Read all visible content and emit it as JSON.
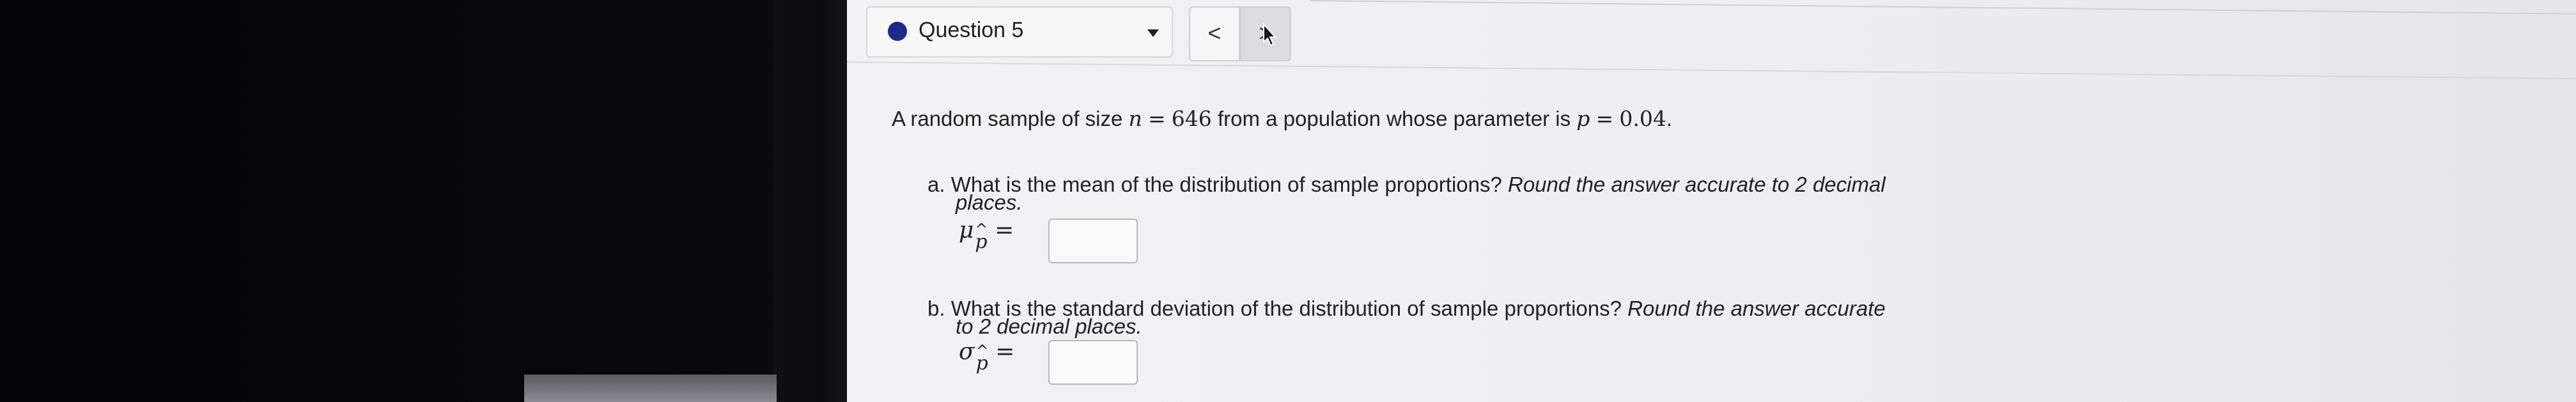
{
  "question_nav": {
    "label": "Question 5",
    "prev_symbol": "<",
    "next_symbol": ">"
  },
  "problem": {
    "intro_text": "A random sample of size",
    "n_symbol": "n",
    "equals": "=",
    "n_value": "646",
    "mid_text": "from a population whose parameter is",
    "p_symbol": "p",
    "p_value": "0.04",
    "end": "."
  },
  "part_a": {
    "marker": "a.",
    "question": "What is the mean of the distribution of sample proportions?",
    "instruction_1": "Round the answer accurate to 2 decimal",
    "instruction_2": "places.",
    "symbol": "μ",
    "sub": "p",
    "hat": "^",
    "equals": "=",
    "answer": ""
  },
  "part_b": {
    "marker": "b.",
    "question": "What is the standard deviation of the distribution of sample proportions?",
    "instruction_1": "Round the answer accurate",
    "instruction_2": "to 2 decimal places.",
    "symbol": "σ",
    "sub": "p",
    "hat": "^",
    "equals": "=",
    "answer": ""
  },
  "colors": {
    "status_dot": "#1c2a8c",
    "page_bg": "#f0f0f2"
  }
}
